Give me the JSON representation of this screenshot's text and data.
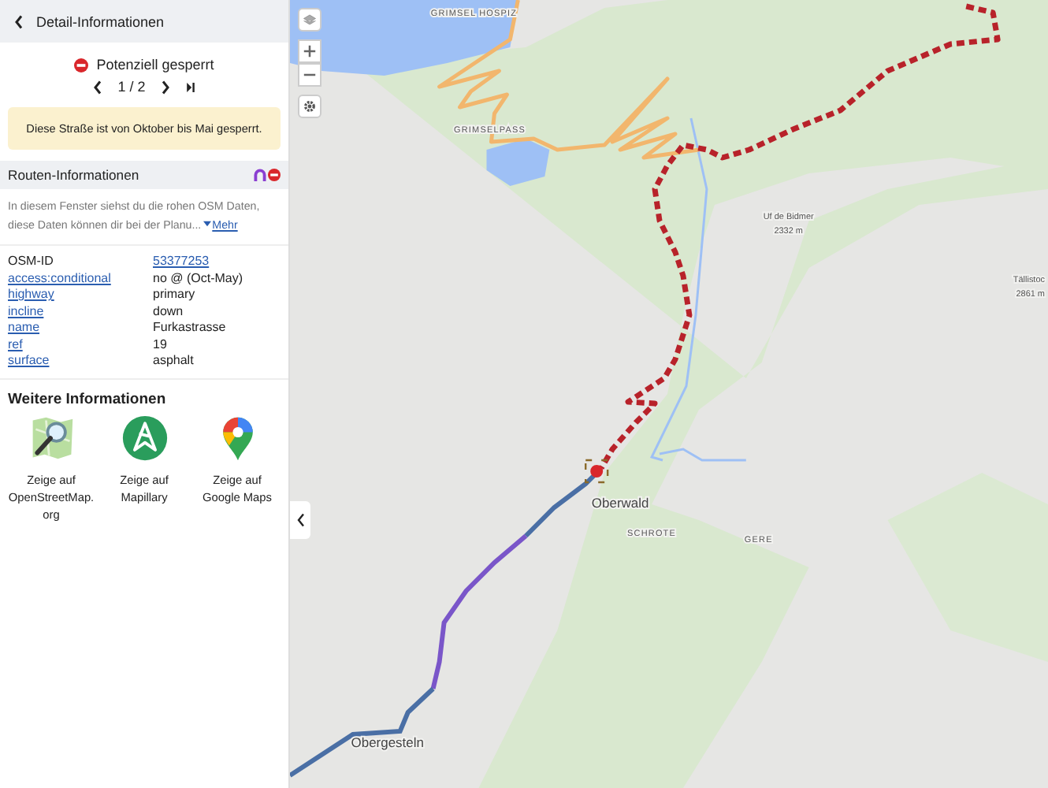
{
  "panel": {
    "title": "Detail-Informationen",
    "status": {
      "label": "Potenziell gesperrt"
    },
    "pager": {
      "position": "1 / 2"
    },
    "notice": "Diese Straße ist von Oktober bis Mai gesperrt.",
    "section_title": "Routen-Informationen",
    "description": "In diesem Fenster siehst du die rohen OSM Daten, diese Daten können dir bei der Planu...",
    "more_link": "Mehr",
    "tags": [
      {
        "key": "OSM-ID",
        "value": "53377253",
        "key_link": false,
        "value_link": true
      },
      {
        "key": "access:conditional",
        "value": "no @ (Oct-May)",
        "key_link": true,
        "value_link": false
      },
      {
        "key": "highway",
        "value": "primary",
        "key_link": true,
        "value_link": false
      },
      {
        "key": "incline",
        "value": "down",
        "key_link": true,
        "value_link": false
      },
      {
        "key": "name",
        "value": "Furkastrasse",
        "key_link": true,
        "value_link": false
      },
      {
        "key": "ref",
        "value": "19",
        "key_link": true,
        "value_link": false
      },
      {
        "key": "surface",
        "value": "asphalt",
        "key_link": true,
        "value_link": false
      }
    ],
    "more_info": {
      "title": "Weitere Informationen",
      "links": [
        {
          "kind": "osm",
          "label": "Zeige auf OpenStreetMap.org"
        },
        {
          "kind": "mapillary",
          "label": "Zeige auf Mapillary"
        },
        {
          "kind": "google",
          "label": "Zeige auf Google Maps"
        }
      ]
    }
  },
  "map": {
    "labels": [
      {
        "kind": "place",
        "text": "GRIMSEL HOSPIZ"
      },
      {
        "kind": "place",
        "text": "GRIMSELPASS"
      },
      {
        "kind": "peak",
        "text": "Uf de Bidmer"
      },
      {
        "kind": "elevation",
        "text": "2332 m"
      },
      {
        "kind": "peak",
        "text": "Tällistoc"
      },
      {
        "kind": "elevation",
        "text": "2861 m"
      },
      {
        "kind": "town",
        "text": "Oberwald"
      },
      {
        "kind": "place",
        "text": "SCHROTE"
      },
      {
        "kind": "place",
        "text": "GERE"
      },
      {
        "kind": "town",
        "text": "Obergesteln"
      }
    ]
  }
}
